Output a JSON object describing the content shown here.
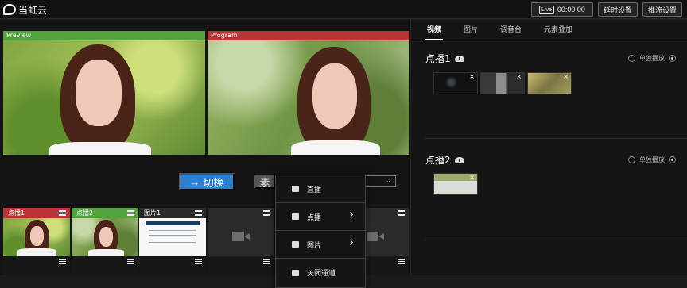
{
  "app": {
    "logo_text": "当虹云",
    "live_tag": "Live",
    "timer": "00:00:00",
    "delay_button": "延时设置",
    "push_button": "推流设置"
  },
  "monitors": {
    "preview_label": "Preview",
    "program_label": "Program"
  },
  "controls": {
    "switch_button": "切换",
    "switch_icon": "→",
    "hidden_button_text": "素",
    "dropdown_icon": "chevron-down-icon"
  },
  "channels": [
    {
      "label": "点播1",
      "status": "program",
      "thumbnail": "person-photo"
    },
    {
      "label": "点播2",
      "status": "preview",
      "thumbnail": "person-photo"
    },
    {
      "label": "图片1",
      "status": "idle",
      "thumbnail": "document-image"
    },
    {
      "label": "",
      "status": "idle",
      "thumbnail": "camera-icon"
    },
    {
      "label": "",
      "status": "idle",
      "thumbnail": "camera-icon"
    }
  ],
  "context_menu": [
    {
      "label": "直播",
      "icon": "camera-icon",
      "has_submenu": false
    },
    {
      "label": "点播",
      "icon": "film-icon",
      "has_submenu": true
    },
    {
      "label": "图片",
      "icon": "image-icon",
      "has_submenu": true
    },
    {
      "label": "关闭通道",
      "icon": "close-square-icon",
      "has_submenu": false
    }
  ],
  "right_panel": {
    "tabs": [
      "视频",
      "图片",
      "调音台",
      "元素叠加"
    ],
    "active_tab": "视频",
    "sections": [
      {
        "title": "点播1",
        "mode": "单独播放",
        "thumbnails": [
          "dark-video",
          "mixed-video",
          "olive-video"
        ]
      },
      {
        "title": "点播2",
        "mode": "单独播放",
        "thumbnails": [
          "green-video"
        ]
      }
    ]
  },
  "colors": {
    "preview": "#52a33c",
    "program": "#b93535",
    "primary": "#2f7fd0"
  }
}
